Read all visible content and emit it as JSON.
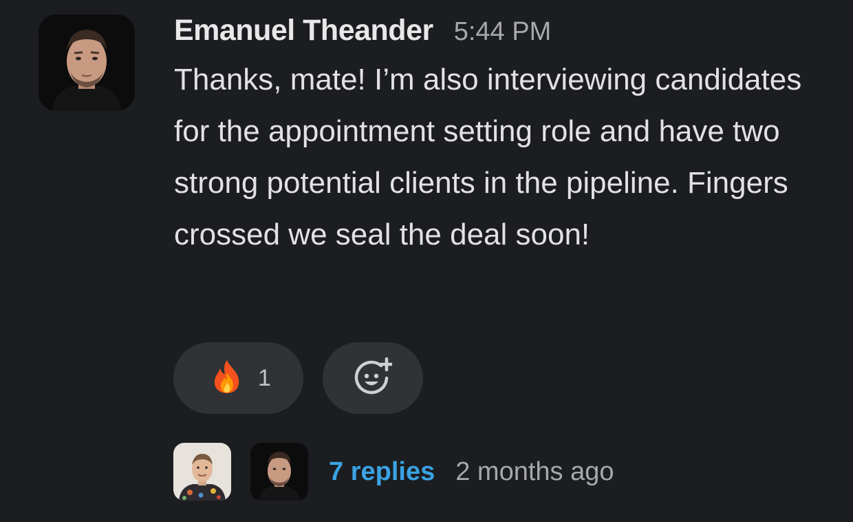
{
  "message": {
    "author": "Emanuel Theander",
    "time": "5:44 PM",
    "text": "Thanks, mate! I’m also interviewing candidates for the appointment setting role and have two strong potential clients in the pipeline. Fingers crossed we seal the deal soon!"
  },
  "reactions": [
    {
      "emoji": "fire-icon",
      "count": "1"
    },
    {
      "emoji": "add-reaction-icon"
    }
  ],
  "thread": {
    "replies_label": "7 replies",
    "last_reply": "2 months ago"
  },
  "colors": {
    "background": "#1b1d21",
    "link": "#3aa3e3",
    "pill": "#303235"
  }
}
